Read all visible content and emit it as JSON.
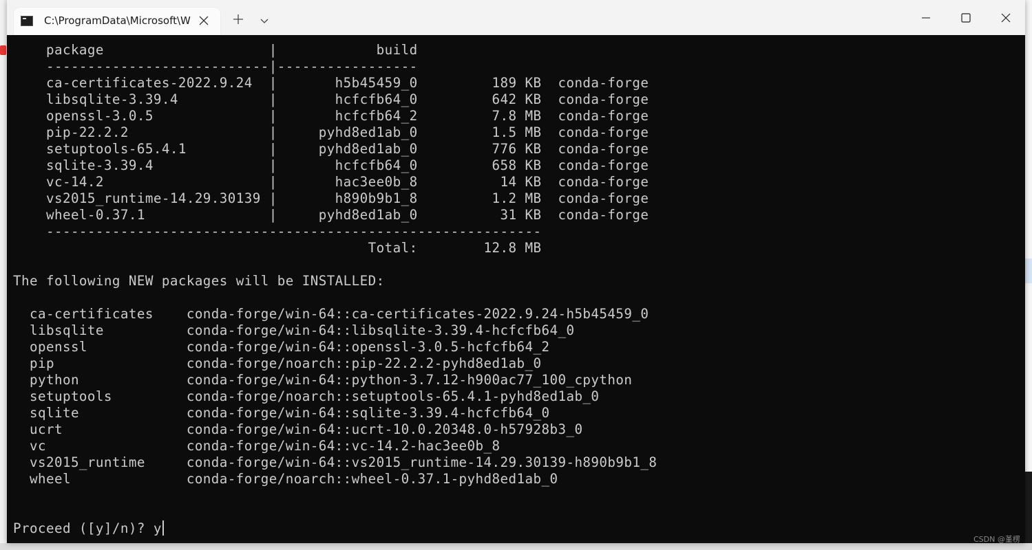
{
  "window": {
    "tab_title": "C:\\ProgramData\\Microsoft\\W",
    "tab_close_icon": "close-icon",
    "new_tab_icon": "plus-icon",
    "dropdown_icon": "chevron-down-icon",
    "minimize_icon": "minimize-icon",
    "maximize_icon": "maximize-icon",
    "close_icon": "close-icon"
  },
  "terminal": {
    "lines": [
      "    package                    |            build",
      "    ---------------------------|-----------------",
      "    ca-certificates-2022.9.24  |       h5b45459_0         189 KB  conda-forge",
      "    libsqlite-3.39.4           |       hcfcfb64_0         642 KB  conda-forge",
      "    openssl-3.0.5              |       hcfcfb64_2         7.8 MB  conda-forge",
      "    pip-22.2.2                 |     pyhd8ed1ab_0         1.5 MB  conda-forge",
      "    setuptools-65.4.1          |     pyhd8ed1ab_0         776 KB  conda-forge",
      "    sqlite-3.39.4              |       hcfcfb64_0         658 KB  conda-forge",
      "    vc-14.2                    |       hac3ee0b_8          14 KB  conda-forge",
      "    vs2015_runtime-14.29.30139 |       h890b9b1_8         1.2 MB  conda-forge",
      "    wheel-0.37.1               |     pyhd8ed1ab_0          31 KB  conda-forge",
      "    ------------------------------------------------------------",
      "                                           Total:        12.8 MB",
      "",
      "The following NEW packages will be INSTALLED:",
      "",
      "  ca-certificates    conda-forge/win-64::ca-certificates-2022.9.24-h5b45459_0",
      "  libsqlite          conda-forge/win-64::libsqlite-3.39.4-hcfcfb64_0",
      "  openssl            conda-forge/win-64::openssl-3.0.5-hcfcfb64_2",
      "  pip                conda-forge/noarch::pip-22.2.2-pyhd8ed1ab_0",
      "  python             conda-forge/win-64::python-3.7.12-h900ac77_100_cpython",
      "  setuptools         conda-forge/noarch::setuptools-65.4.1-pyhd8ed1ab_0",
      "  sqlite             conda-forge/win-64::sqlite-3.39.4-hcfcfb64_0",
      "  ucrt               conda-forge/win-64::ucrt-10.0.20348.0-h57928b3_0",
      "  vc                 conda-forge/win-64::vc-14.2-hac3ee0b_8",
      "  vs2015_runtime     conda-forge/win-64::vs2015_runtime-14.29.30139-h890b9b1_8",
      "  wheel              conda-forge/noarch::wheel-0.37.1-pyhd8ed1ab_0",
      "",
      ""
    ],
    "prompt": "Proceed ([y]/n)? y"
  },
  "watermark": "CSDN @堇楞",
  "colors": {
    "terminal_bg": "#0c0c0c",
    "terminal_fg": "#cccccc",
    "titlebar_bg": "#f3f3f3"
  }
}
